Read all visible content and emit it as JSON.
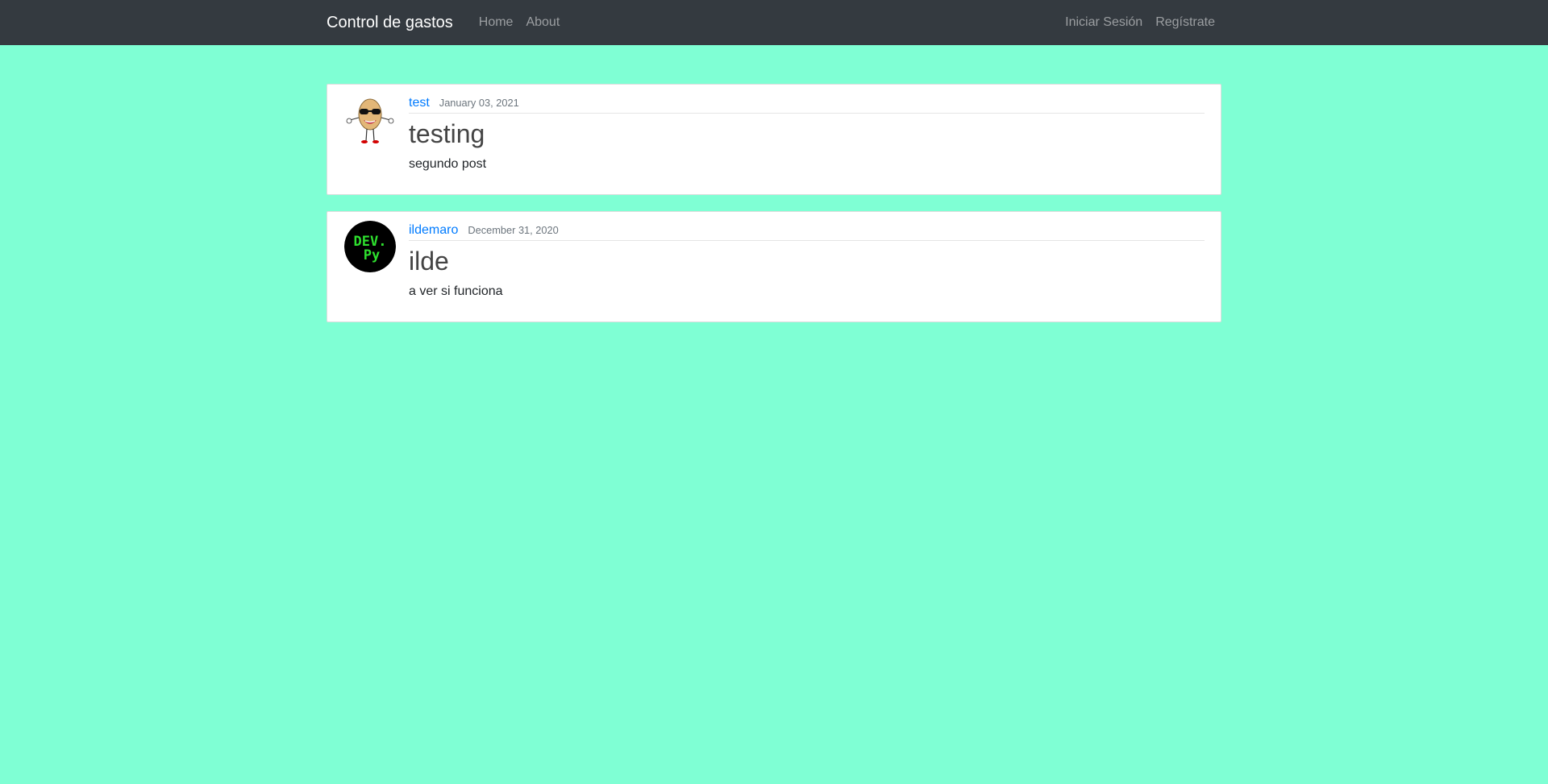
{
  "navbar": {
    "brand": "Control de gastos",
    "links": [
      "Home",
      "About"
    ],
    "right_links": [
      "Iniciar Sesión",
      "Regístrate"
    ]
  },
  "posts": [
    {
      "author": "test",
      "date": "January 03, 2021",
      "title": "testing",
      "content": "segundo post",
      "avatar": "cartoon-peanut-avatar"
    },
    {
      "author": "ildemaro",
      "date": "December 31, 2020",
      "title": "ilde",
      "content": "a ver si funciona",
      "avatar": "dev-py-logo-avatar",
      "avatar_text": [
        "DEV.",
        "Py"
      ]
    }
  ],
  "colors": {
    "page_background": "#7fffd4",
    "navbar_background": "#343a40",
    "link_blue": "#007bff"
  }
}
